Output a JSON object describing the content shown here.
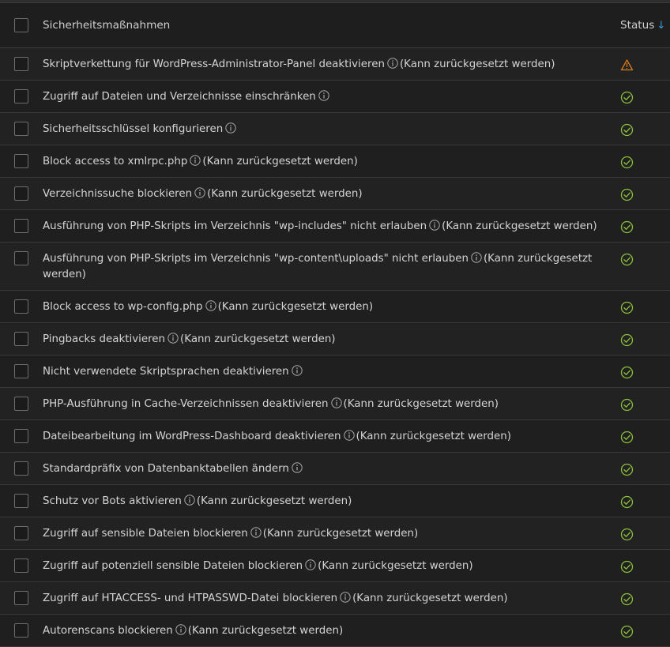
{
  "header": {
    "title": "Sicherheitsmaßnahmen",
    "status_label": "Status",
    "sort_glyph": "↓"
  },
  "colors": {
    "ok": "#8bbf3c",
    "warning": "#d67b1e",
    "sort": "#3d9bd6"
  },
  "rows": [
    {
      "label": "Skriptverkettung für WordPress-Administrator-Panel deaktivieren",
      "suffix": "(Kann zurückgesetzt werden)",
      "status": "warning",
      "status_icon": "warning-triangle-icon"
    },
    {
      "label": "Zugriff auf Dateien und Verzeichnisse einschränken",
      "suffix": "",
      "status": "ok",
      "status_icon": "check-circle-icon"
    },
    {
      "label": "Sicherheitsschlüssel konfigurieren",
      "suffix": "",
      "status": "ok",
      "status_icon": "check-circle-icon"
    },
    {
      "label": "Block access to xmlrpc.php",
      "suffix": "(Kann zurückgesetzt werden)",
      "status": "ok",
      "status_icon": "check-circle-icon"
    },
    {
      "label": "Verzeichnissuche blockieren",
      "suffix": "(Kann zurückgesetzt werden)",
      "status": "ok",
      "status_icon": "check-circle-icon"
    },
    {
      "label": "Ausführung von PHP-Skripts im Verzeichnis \"wp-includes\" nicht erlauben",
      "suffix": "(Kann zurückgesetzt werden)",
      "status": "ok",
      "status_icon": "check-circle-icon"
    },
    {
      "label": "Ausführung von PHP-Skripts im Verzeichnis \"wp-content\\uploads\" nicht erlauben",
      "suffix": "(Kann zurückgesetzt werden)",
      "status": "ok",
      "status_icon": "check-circle-icon"
    },
    {
      "label": "Block access to wp-config.php",
      "suffix": "(Kann zurückgesetzt werden)",
      "status": "ok",
      "status_icon": "check-circle-icon"
    },
    {
      "label": "Pingbacks deaktivieren",
      "suffix": "(Kann zurückgesetzt werden)",
      "status": "ok",
      "status_icon": "check-circle-icon"
    },
    {
      "label": "Nicht verwendete Skriptsprachen deaktivieren",
      "suffix": "",
      "status": "ok",
      "status_icon": "check-circle-icon"
    },
    {
      "label": "PHP-Ausführung in Cache-Verzeichnissen deaktivieren",
      "suffix": "(Kann zurückgesetzt werden)",
      "status": "ok",
      "status_icon": "check-circle-icon"
    },
    {
      "label": "Dateibearbeitung im WordPress-Dashboard deaktivieren",
      "suffix": "(Kann zurückgesetzt werden)",
      "status": "ok",
      "status_icon": "check-circle-icon"
    },
    {
      "label": "Standardpräfix von Datenbanktabellen ändern",
      "suffix": "",
      "status": "ok",
      "status_icon": "check-circle-icon"
    },
    {
      "label": "Schutz vor Bots aktivieren",
      "suffix": "(Kann zurückgesetzt werden)",
      "status": "ok",
      "status_icon": "check-circle-icon"
    },
    {
      "label": "Zugriff auf sensible Dateien blockieren",
      "suffix": "(Kann zurückgesetzt werden)",
      "status": "ok",
      "status_icon": "check-circle-icon"
    },
    {
      "label": "Zugriff auf potenziell sensible Dateien blockieren",
      "suffix": "(Kann zurückgesetzt werden)",
      "status": "ok",
      "status_icon": "check-circle-icon"
    },
    {
      "label": "Zugriff auf HTACCESS- und HTPASSWD-Datei blockieren",
      "suffix": "(Kann zurückgesetzt werden)",
      "status": "ok",
      "status_icon": "check-circle-icon"
    },
    {
      "label": "Autorenscans blockieren",
      "suffix": "(Kann zurückgesetzt werden)",
      "status": "ok",
      "status_icon": "check-circle-icon"
    }
  ]
}
